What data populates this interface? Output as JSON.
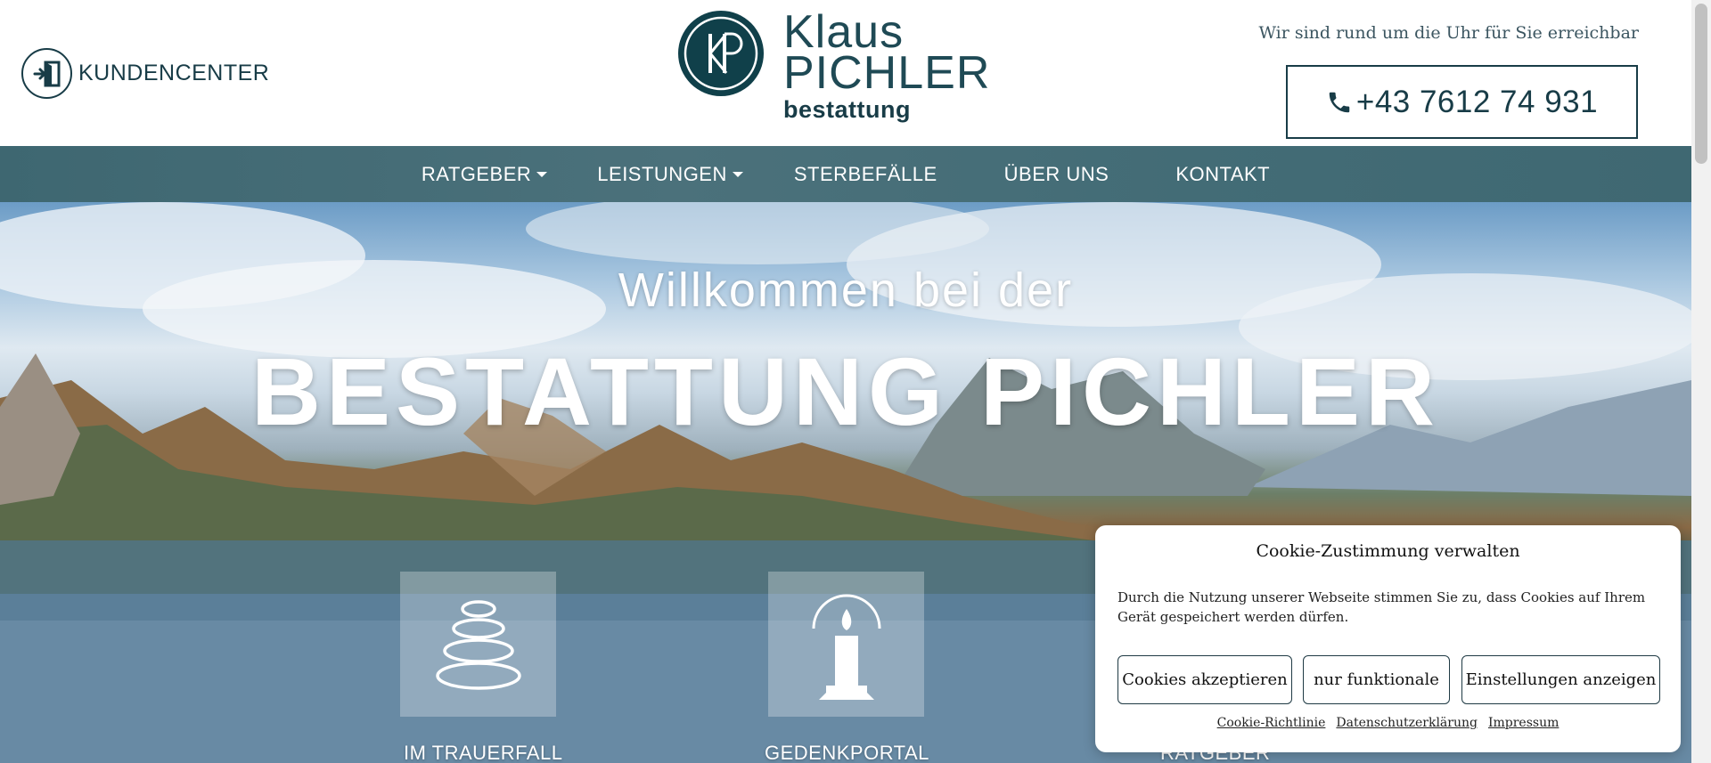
{
  "header": {
    "kundencenter_label": "KUNDENCENTER",
    "logo": {
      "line1": "Klaus",
      "line2": "PICHLER",
      "line3": "bestattung",
      "monogram": "KP"
    },
    "availability_text": "Wir sind rund um die Uhr für Sie erreichbar",
    "phone_number": "+43 7612 74 931"
  },
  "nav": {
    "items": [
      {
        "label": "RATGEBER",
        "has_dropdown": true
      },
      {
        "label": "LEISTUNGEN",
        "has_dropdown": true
      },
      {
        "label": "STERBEFÄLLE",
        "has_dropdown": false
      },
      {
        "label": "ÜBER UNS",
        "has_dropdown": false
      },
      {
        "label": "KONTAKT",
        "has_dropdown": false
      }
    ]
  },
  "hero": {
    "welcome": "Willkommen bei der",
    "title": "BESTATTUNG PICHLER",
    "tiles": [
      {
        "label": "IM TRAUERFALL",
        "icon": "stacked-stones-icon"
      },
      {
        "label": "GEDENKPORTAL",
        "icon": "candle-icon"
      },
      {
        "label": "RATGEBER",
        "icon": "book-icon"
      }
    ]
  },
  "cookie": {
    "title": "Cookie-Zustimmung verwalten",
    "text": "Durch die Nutzung unserer Webseite stimmen Sie zu, dass Cookies auf Ihrem Gerät gespeichert werden dürfen.",
    "buttons": {
      "accept": "Cookies akzeptieren",
      "functional": "nur funktionale",
      "settings": "Einstellungen anzeigen"
    },
    "links": {
      "cookie_policy": "Cookie-Richtlinie",
      "privacy": "Datenschutzerklärung",
      "imprint": "Impressum"
    }
  },
  "colors": {
    "brand_dark": "#183c47",
    "nav_bg": "#456d77"
  }
}
